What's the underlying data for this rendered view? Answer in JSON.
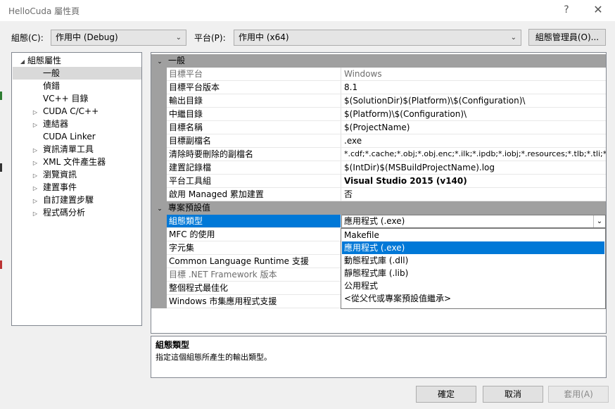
{
  "window": {
    "title": "HelloCuda 屬性頁",
    "help": "?",
    "close": "✕"
  },
  "toolbar": {
    "config_label": "組態(C):",
    "config_value": "作用中 (Debug)",
    "platform_label": "平台(P):",
    "platform_value": "作用中 (x64)",
    "config_manager": "組態管理員(O)..."
  },
  "tree": {
    "root": "組態屬性",
    "items": [
      {
        "label": "一般",
        "expandable": false
      },
      {
        "label": "偵錯",
        "expandable": false
      },
      {
        "label": "VC++ 目錄",
        "expandable": false
      },
      {
        "label": "CUDA C/C++",
        "expandable": true
      },
      {
        "label": "連結器",
        "expandable": true
      },
      {
        "label": "CUDA Linker",
        "expandable": false
      },
      {
        "label": "資訊清單工具",
        "expandable": true
      },
      {
        "label": "XML 文件產生器",
        "expandable": true
      },
      {
        "label": "瀏覽資訊",
        "expandable": true
      },
      {
        "label": "建置事件",
        "expandable": true
      },
      {
        "label": "自訂建置步驟",
        "expandable": true
      },
      {
        "label": "程式碼分析",
        "expandable": true
      }
    ]
  },
  "grid": {
    "general_header": "一般",
    "general_rows": [
      {
        "name": "目標平台",
        "value": "Windows",
        "grey": true
      },
      {
        "name": "目標平台版本",
        "value": "8.1"
      },
      {
        "name": "輸出目錄",
        "value": "$(SolutionDir)$(Platform)\\$(Configuration)\\"
      },
      {
        "name": "中繼目錄",
        "value": "$(Platform)\\$(Configuration)\\"
      },
      {
        "name": "目標名稱",
        "value": "$(ProjectName)"
      },
      {
        "name": "目標副檔名",
        "value": ".exe"
      },
      {
        "name": "清除時要刪除的副檔名",
        "value": "*.cdf;*.cache;*.obj;*.obj.enc;*.ilk;*.ipdb;*.iobj;*.resources;*.tlb;*.tli;*.t"
      },
      {
        "name": "建置記錄檔",
        "value": "$(IntDir)$(MSBuildProjectName).log"
      },
      {
        "name": "平台工具組",
        "value": "Visual Studio 2015 (v140)",
        "bold": true
      },
      {
        "name": "啟用 Managed 累加建置",
        "value": "否"
      }
    ],
    "defaults_header": "專案預設值",
    "defaults_rows": [
      {
        "name": "組態類型",
        "value": "應用程式 (.exe)"
      },
      {
        "name": "MFC 的使用",
        "value": ""
      },
      {
        "name": "字元集",
        "value": ""
      },
      {
        "name": "Common Language Runtime 支援",
        "value": ""
      },
      {
        "name": "目標 .NET Framework 版本",
        "value": "",
        "grey": true
      },
      {
        "name": "整個程式最佳化",
        "value": ""
      },
      {
        "name": "Windows 市集應用程式支援",
        "value": ""
      }
    ]
  },
  "dropdown": {
    "options": [
      "Makefile",
      "應用程式 (.exe)",
      "動態程式庫 (.dll)",
      "靜態程式庫 (.lib)",
      "公用程式",
      "<從父代或專案預設值繼承>"
    ],
    "highlighted_index": 1
  },
  "description": {
    "title": "組態類型",
    "body": "指定這個組態所產生的輸出類型。"
  },
  "buttons": {
    "ok": "確定",
    "cancel": "取消",
    "apply": "套用(A)"
  },
  "colors": {
    "selection": "#0078d7",
    "category": "#a0a0a0"
  }
}
